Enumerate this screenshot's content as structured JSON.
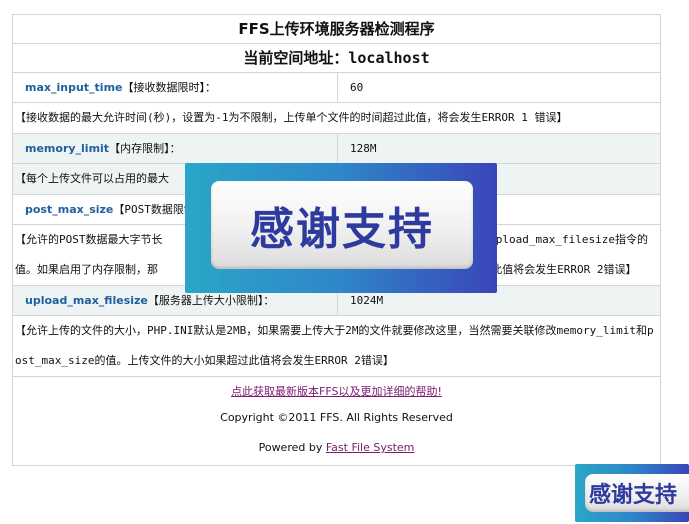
{
  "header": {
    "title": "FFS上传环境服务器检测程序",
    "address_label": "当前空间地址：",
    "address_value": "localhost"
  },
  "settings": [
    {
      "key": "max_input_time",
      "label": "【接收数据限时】：",
      "value": "60",
      "description": "【接收数据的最大允许时间(秒)，设置为-1为不限制，上传单个文件的时间超过此值，将会发生ERROR 1 错误】"
    },
    {
      "key": "memory_limit",
      "label": "【内存限制】：",
      "value": "128M",
      "description": "【每个上传文件可以占用的最大"
    },
    {
      "key": "post_max_size",
      "label": "【POST数据限制",
      "value": "",
      "description": "【允许的POST数据最大字节长                                              大于upload_max_filesize指令的值。如果启用了内存限制，那                                          小如果超过此值将会发生ERROR 2错误】"
    },
    {
      "key": "upload_max_filesize",
      "label": "【服务器上传大小限制】：",
      "value": "1024M",
      "description": "【允许上传的文件的大小，PHP.INI默认是2MB，如果需要上传大于2M的文件就要修改这里，当然需要关联修改memory_limit和post_max_size的值。上传文件的大小如果超过此值将会发生ERROR 2错误】"
    }
  ],
  "footer": {
    "help_link": "点此获取最新版本FFS以及更加详细的帮助!",
    "copyright": "Copyright ©2011 FFS. All Rights Reserved",
    "powered_prefix": "Powered by",
    "powered_link": "Fast File System"
  },
  "overlays": {
    "banner_large": "感谢支持",
    "banner_small": "感谢支持"
  }
}
